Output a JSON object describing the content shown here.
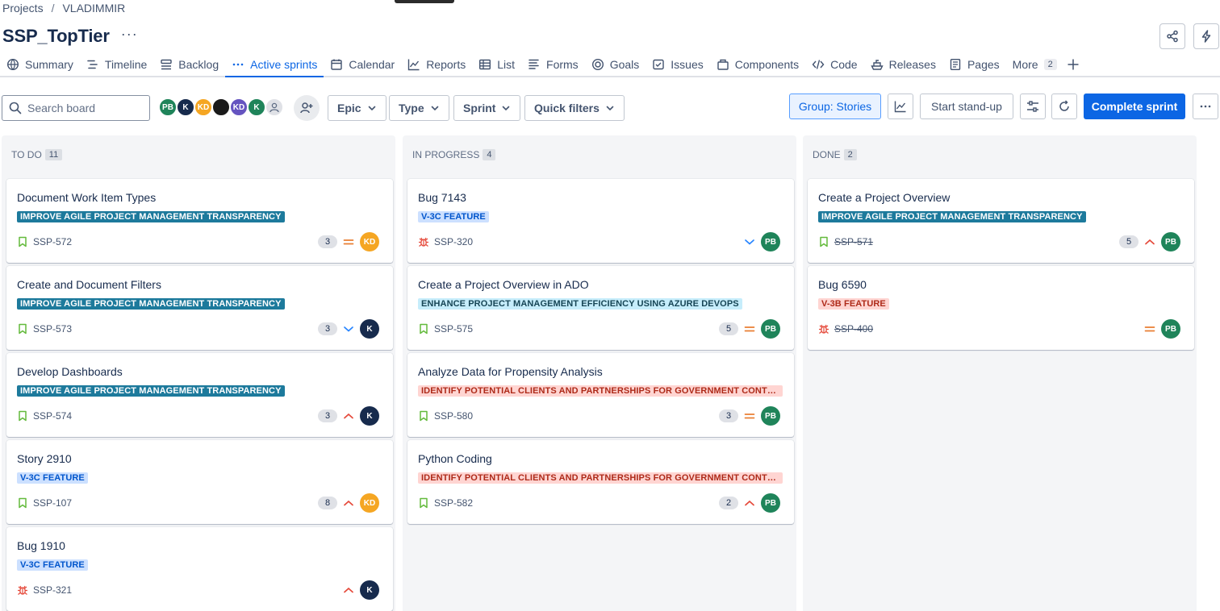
{
  "breadcrumb": {
    "projects": "Projects",
    "separator": "/",
    "current": "VLADIMMIR"
  },
  "page": {
    "title": "SSP_TopTier",
    "more": "···"
  },
  "tabs": [
    {
      "label": "Summary",
      "icon": "globe-icon"
    },
    {
      "label": "Timeline",
      "icon": "timeline-icon"
    },
    {
      "label": "Backlog",
      "icon": "backlog-icon"
    },
    {
      "label": "Active sprints",
      "icon": "dots-icon",
      "active": true
    },
    {
      "label": "Calendar",
      "icon": "calendar-icon"
    },
    {
      "label": "Reports",
      "icon": "chart-icon"
    },
    {
      "label": "List",
      "icon": "list-icon"
    },
    {
      "label": "Forms",
      "icon": "forms-icon"
    },
    {
      "label": "Goals",
      "icon": "target-icon"
    },
    {
      "label": "Issues",
      "icon": "issues-icon"
    },
    {
      "label": "Components",
      "icon": "components-icon"
    },
    {
      "label": "Code",
      "icon": "code-icon"
    },
    {
      "label": "Releases",
      "icon": "ship-icon"
    },
    {
      "label": "Pages",
      "icon": "page-icon"
    }
  ],
  "more_tab": {
    "label": "More",
    "count": "2"
  },
  "toolbar": {
    "search_placeholder": "Search board",
    "avatars": [
      {
        "initials": "PB",
        "color": "#1f845a"
      },
      {
        "initials": "K",
        "color": "#172b4d"
      },
      {
        "initials": "KD",
        "color": "#f5a623"
      },
      {
        "initials": "",
        "color": "#1a1a1a"
      },
      {
        "initials": "KD",
        "color": "#6554c0"
      },
      {
        "initials": "K",
        "color": "#1f845a"
      },
      {
        "initials": "",
        "color": "#dfe1e6"
      }
    ],
    "filters": [
      "Epic",
      "Type",
      "Sprint",
      "Quick filters"
    ],
    "group_label": "Group: Stories",
    "standup_label": "Start stand-up",
    "complete_label": "Complete sprint"
  },
  "columns": [
    {
      "name": "TO DO",
      "count": "11",
      "cards": [
        {
          "title": "Document Work Item Types",
          "epic": "IMPROVE AGILE PROJECT MANAGEMENT TRANSPARENCY",
          "epic_style": "teal",
          "type": "story",
          "key": "SSP-572",
          "points": "3",
          "priority": "medium",
          "assignee": "KD",
          "assignee_color": "#f5a623",
          "done": false
        },
        {
          "title": "Create and Document Filters",
          "epic": "IMPROVE AGILE PROJECT MANAGEMENT TRANSPARENCY",
          "epic_style": "teal",
          "type": "story",
          "key": "SSP-573",
          "points": "3",
          "priority": "low",
          "assignee": "K",
          "assignee_color": "#172b4d",
          "done": false
        },
        {
          "title": "Develop Dashboards",
          "epic": "IMPROVE AGILE PROJECT MANAGEMENT TRANSPARENCY",
          "epic_style": "teal",
          "type": "story",
          "key": "SSP-574",
          "points": "3",
          "priority": "high",
          "assignee": "K",
          "assignee_color": "#172b4d",
          "done": false
        },
        {
          "title": "Story 2910",
          "epic": "V-3C FEATURE",
          "epic_style": "blue",
          "type": "story",
          "key": "SSP-107",
          "points": "8",
          "priority": "high",
          "assignee": "KD",
          "assignee_color": "#f5a623",
          "done": false
        },
        {
          "title": "Bug 1910",
          "epic": "V-3C FEATURE",
          "epic_style": "blue",
          "type": "bug",
          "key": "SSP-321",
          "points": "",
          "priority": "high",
          "assignee": "K",
          "assignee_color": "#172b4d",
          "done": false
        }
      ]
    },
    {
      "name": "IN PROGRESS",
      "count": "4",
      "cards": [
        {
          "title": "Bug 7143",
          "epic": "V-3C FEATURE",
          "epic_style": "blue",
          "type": "bug",
          "key": "SSP-320",
          "points": "",
          "priority": "low",
          "assignee": "PB",
          "assignee_color": "#1f845a",
          "done": false
        },
        {
          "title": "Create a Project Overview in ADO",
          "epic": "ENHANCE PROJECT MANAGEMENT EFFICIENCY USING AZURE DEVOPS",
          "epic_style": "cyan",
          "type": "story",
          "key": "SSP-575",
          "points": "5",
          "priority": "medium",
          "assignee": "PB",
          "assignee_color": "#1f845a",
          "done": false
        },
        {
          "title": "Analyze Data for Propensity Analysis",
          "epic": "IDENTIFY POTENTIAL CLIENTS AND PARTNERSHIPS FOR GOVERNMENT CONTRACTING",
          "epic_style": "red",
          "type": "story",
          "key": "SSP-580",
          "points": "3",
          "priority": "medium",
          "assignee": "PB",
          "assignee_color": "#1f845a",
          "done": false
        },
        {
          "title": "Python Coding",
          "epic": "IDENTIFY POTENTIAL CLIENTS AND PARTNERSHIPS FOR GOVERNMENT CONTRACTING",
          "epic_style": "red",
          "type": "story",
          "key": "SSP-582",
          "points": "2",
          "priority": "high",
          "assignee": "PB",
          "assignee_color": "#1f845a",
          "done": false
        }
      ]
    },
    {
      "name": "DONE",
      "count": "2",
      "cards": [
        {
          "title": "Create a Project Overview",
          "epic": "IMPROVE AGILE PROJECT MANAGEMENT TRANSPARENCY",
          "epic_style": "teal",
          "type": "story",
          "key": "SSP-571",
          "points": "5",
          "priority": "high",
          "assignee": "PB",
          "assignee_color": "#1f845a",
          "done": true
        },
        {
          "title": "Bug 6590",
          "epic": "V-3B FEATURE",
          "epic_style": "red",
          "type": "bug",
          "key": "SSP-400",
          "points": "",
          "priority": "medium",
          "assignee": "PB",
          "assignee_color": "#1f845a",
          "done": true
        }
      ]
    }
  ],
  "colors": {
    "accent": "#0c66e4",
    "priority_high": "#e5493a",
    "priority_medium": "#e97f33",
    "priority_low": "#2684ff",
    "story_icon": "#63ba3c",
    "bug_icon": "#e5493a"
  }
}
